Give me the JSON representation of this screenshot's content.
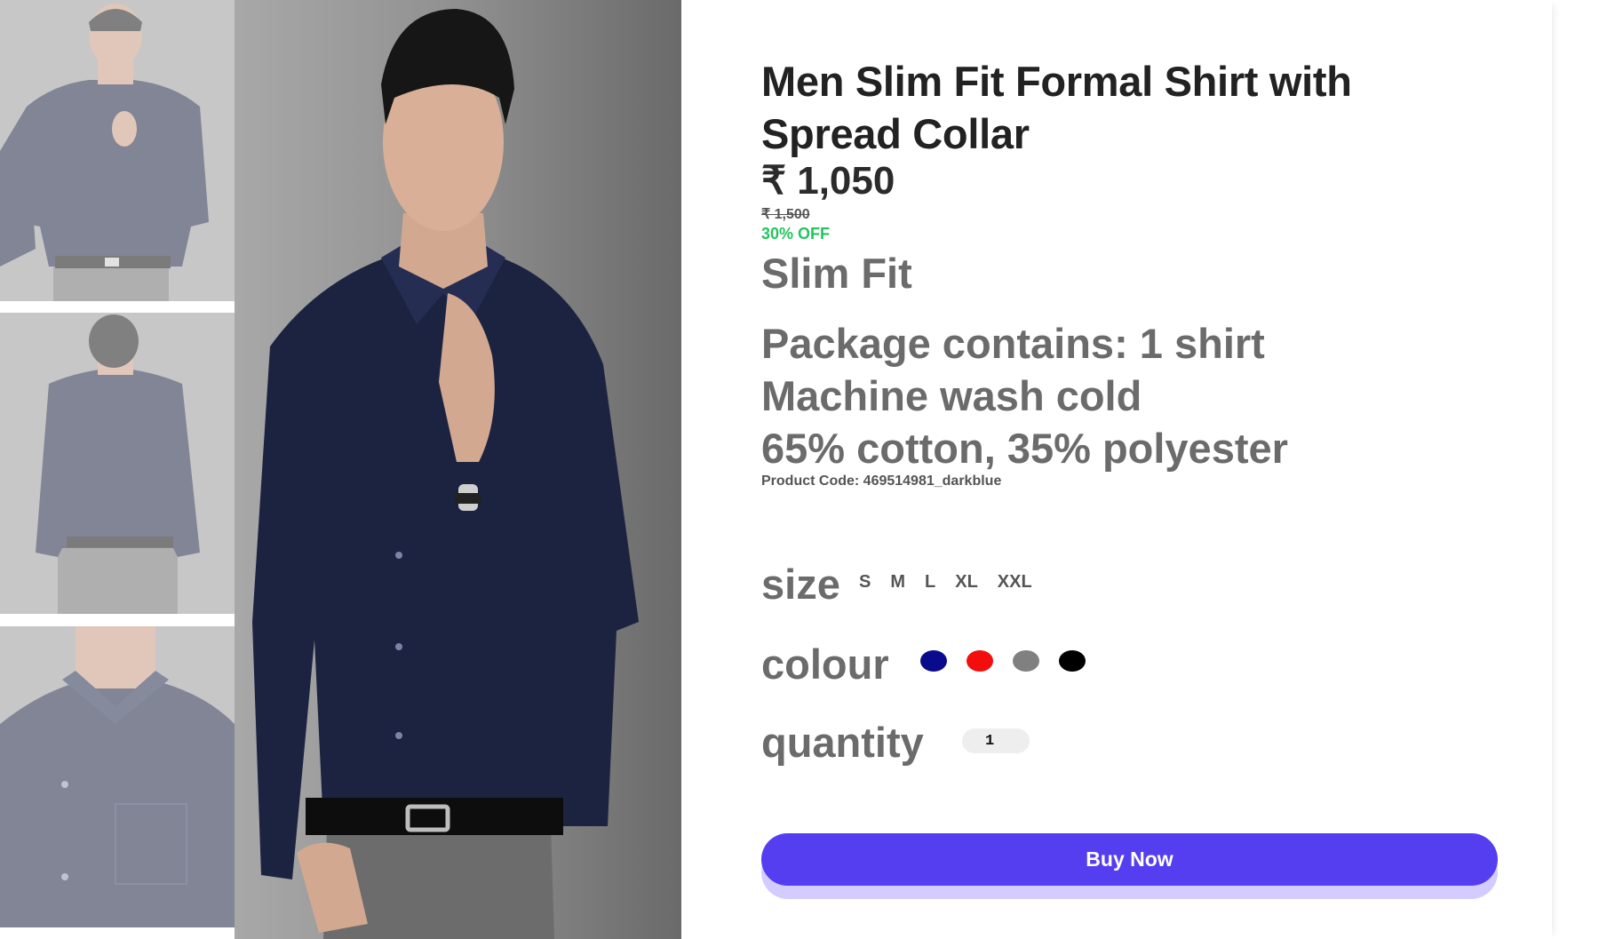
{
  "product": {
    "title": "Men Slim Fit Formal Shirt with Spread Collar",
    "price": "₹ 1,050",
    "original_price": "₹ 1,500",
    "discount": "30% OFF",
    "fit": "Slim Fit",
    "features": [
      "Package contains: 1 shirt",
      "Machine wash cold",
      "65% cotton, 35% polyester"
    ],
    "product_code": "Product Code: 469514981_darkblue"
  },
  "options": {
    "size_label": "size",
    "sizes": [
      "S",
      "M",
      "L",
      "XL",
      "XXL"
    ],
    "colour_label": "colour",
    "colours": [
      {
        "name": "navy",
        "hex": "#0a0a8c"
      },
      {
        "name": "red",
        "hex": "#f40d0d"
      },
      {
        "name": "grey",
        "hex": "#808080"
      },
      {
        "name": "black",
        "hex": "#000000"
      }
    ],
    "quantity_label": "quantity",
    "quantity_value": "1"
  },
  "actions": {
    "buy_label": "Buy Now"
  },
  "theme": {
    "accent": "#553ef0",
    "discount_color": "#22c55e",
    "shirt_color": "#1c2340"
  },
  "gallery": {
    "thumbnails": [
      "front-pose",
      "back-view",
      "collar-closeup"
    ],
    "main": "front-pose"
  }
}
